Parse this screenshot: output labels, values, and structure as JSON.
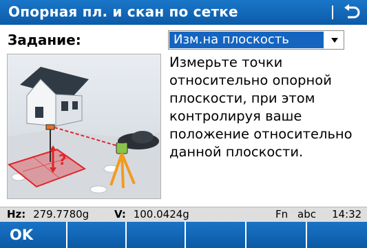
{
  "window": {
    "title": "Опорная пл. и скан по сетке",
    "back_icon": "return-arrow-icon"
  },
  "task": {
    "label": "Задание:",
    "selected": "Изм.на плоскость"
  },
  "illustration": {
    "description_icon": "surveying-reference-plane-illustration"
  },
  "instruction": {
    "text": "Измерьте точки относительно опорной плоскости, при этом контролируя ваше положение относительно данной плоскости."
  },
  "status": {
    "hz_label": "Hz:",
    "hz_value": "279.7780g",
    "v_label": "V:",
    "v_value": "100.0424g",
    "fn": "Fn",
    "input_mode": "abc",
    "time": "14:32"
  },
  "softkeys": [
    {
      "label": "OK"
    },
    {
      "label": ""
    },
    {
      "label": ""
    },
    {
      "label": ""
    },
    {
      "label": ""
    },
    {
      "label": ""
    }
  ],
  "colors": {
    "title_bg": "#0c5ba8",
    "select_highlight": "#1565c0",
    "status_bg": "#dedede",
    "plane_red": "#e0242a"
  }
}
